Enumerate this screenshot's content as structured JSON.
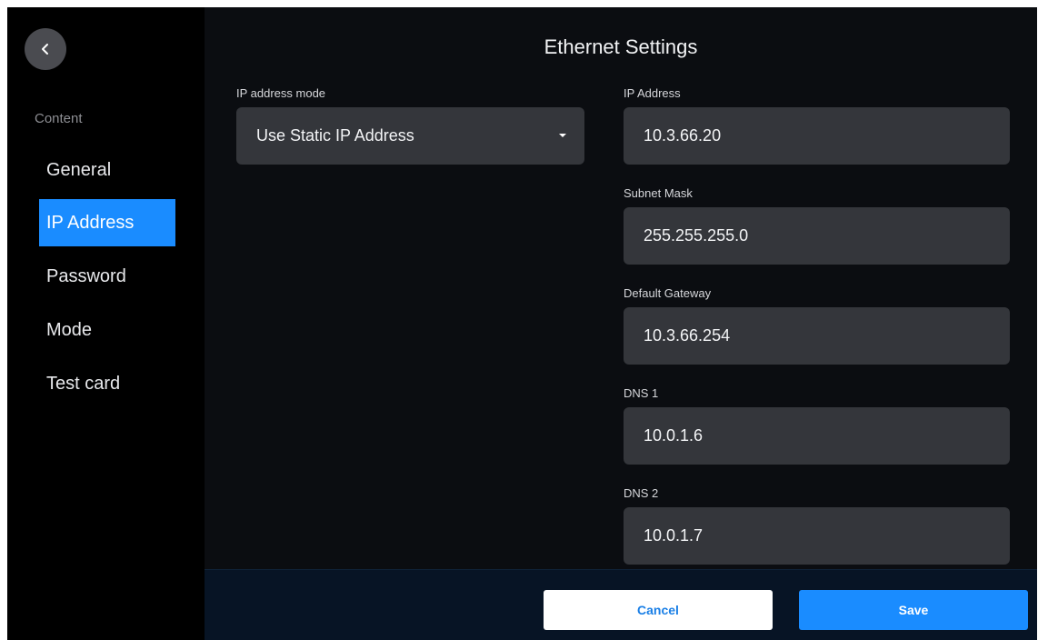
{
  "header": {
    "title": "Ethernet Settings"
  },
  "sidebar": {
    "section_label": "Content",
    "items": [
      {
        "label": "General",
        "active": false
      },
      {
        "label": "IP Address",
        "active": true
      },
      {
        "label": "Password",
        "active": false
      },
      {
        "label": "Mode",
        "active": false
      },
      {
        "label": "Test card",
        "active": false
      }
    ]
  },
  "form": {
    "ip_mode": {
      "label": "IP address mode",
      "value": "Use Static IP Address"
    },
    "ip_address": {
      "label": "IP Address",
      "value": "10.3.66.20"
    },
    "subnet_mask": {
      "label": "Subnet Mask",
      "value": "255.255.255.0"
    },
    "default_gateway": {
      "label": "Default Gateway",
      "value": "10.3.66.254"
    },
    "dns1": {
      "label": "DNS 1",
      "value": "10.0.1.6"
    },
    "dns2": {
      "label": "DNS 2",
      "value": "10.0.1.7"
    }
  },
  "footer": {
    "cancel_label": "Cancel",
    "save_label": "Save"
  },
  "icons": {
    "back": "chevron-left-icon",
    "dropdown": "caret-down-icon"
  },
  "colors": {
    "accent": "#1a8cff",
    "field_bg": "#34363b",
    "footer_bg": "#071425"
  }
}
